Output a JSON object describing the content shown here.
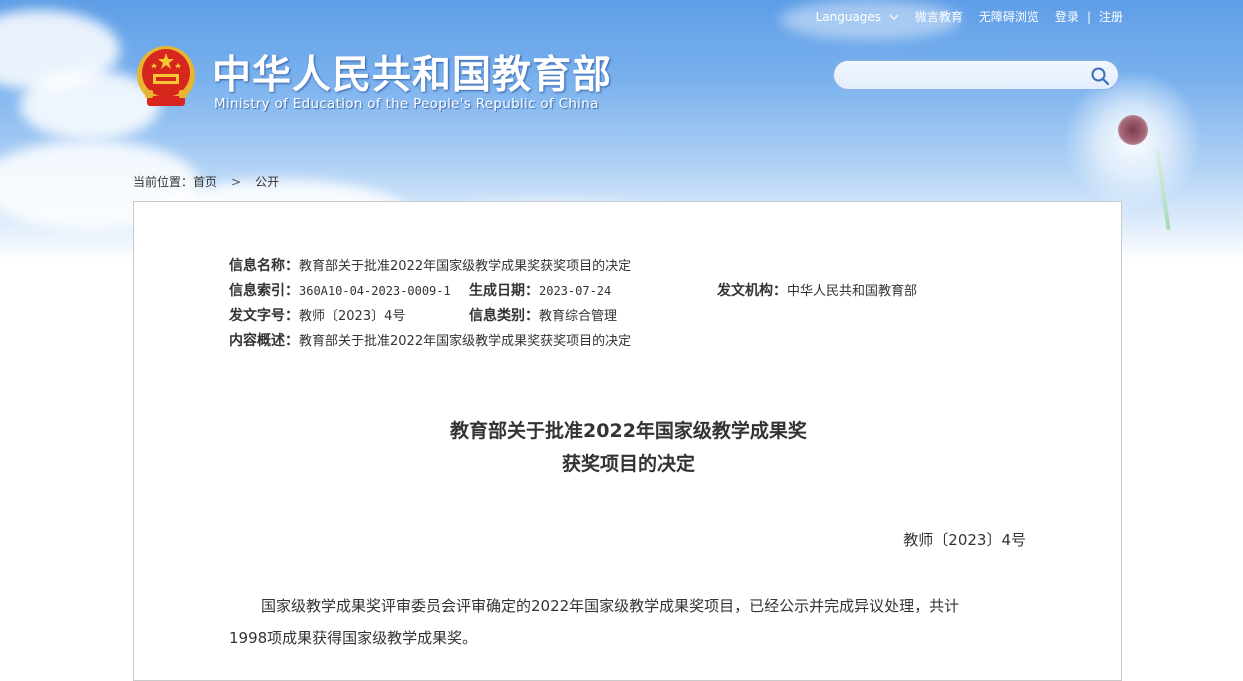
{
  "header": {
    "nav": {
      "languages": "Languages",
      "weiyan": "微言教育",
      "accessible": "无障碍浏览",
      "login": "登录",
      "divider": "|",
      "register": "注册"
    },
    "title_cn": "中华人民共和国教育部",
    "title_en": "Ministry of Education of the People's Republic of China",
    "search": {
      "placeholder": ""
    }
  },
  "breadcrumb": {
    "prefix": "当前位置：",
    "home": "首页",
    "separator": ">",
    "current": "公开"
  },
  "info": {
    "name_label": "信息名称：",
    "name_value": "教育部关于批准2022年国家级教学成果奖获奖项目的决定",
    "index_label": "信息索引：",
    "index_value": "360A10-04-2023-0009-1",
    "date_label": "生成日期：",
    "date_value": "2023-07-24",
    "org_label": "发文机构：",
    "org_value": "中华人民共和国教育部",
    "docno_label": "发文字号：",
    "docno_value": "教师〔2023〕4号",
    "category_label": "信息类别：",
    "category_value": "教育综合管理",
    "summary_label": "内容概述：",
    "summary_value": "教育部关于批准2022年国家级教学成果奖获奖项目的决定"
  },
  "document": {
    "title_line1": "教育部关于批准2022年国家级教学成果奖",
    "title_line2": "获奖项目的决定",
    "number": "教师〔2023〕4号",
    "paragraph1_line1": "国家级教学成果奖评审委员会评审确定的2022年国家级教学成果奖项目，已经公示并完成异议处理，共计",
    "paragraph1_line2": "1998项成果获得国家级教学成果奖。"
  },
  "colors": {
    "sky_top": "#5e9de6",
    "sky_bottom": "#ffffff",
    "text": "#333333",
    "panel_border": "#c9c9c9"
  }
}
